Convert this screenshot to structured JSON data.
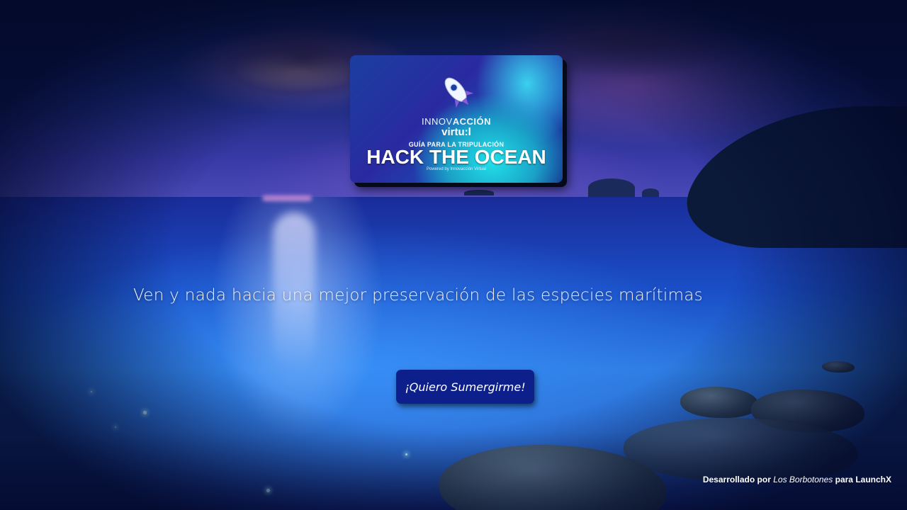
{
  "logo": {
    "innov_prefix": "INNOV",
    "innov_suffix": "ACCIÓN",
    "virtual": "virtu:l",
    "guide": "GUÍA PARA LA TRIPULACIÓN",
    "title": "HACK THE OCEAN",
    "powered": "Powered by Innovacción Virtual",
    "icon": "rocket-icon"
  },
  "hero": {
    "tagline": "Ven y nada hacia una mejor preservación de las especies marítimas"
  },
  "cta": {
    "label": "¡Quiero Sumergirme!",
    "color": "#0d1f8a"
  },
  "footer": {
    "prefix": "Desarrollado por",
    "team": "Los Borbotones",
    "middle": "para",
    "org": "LaunchX"
  }
}
